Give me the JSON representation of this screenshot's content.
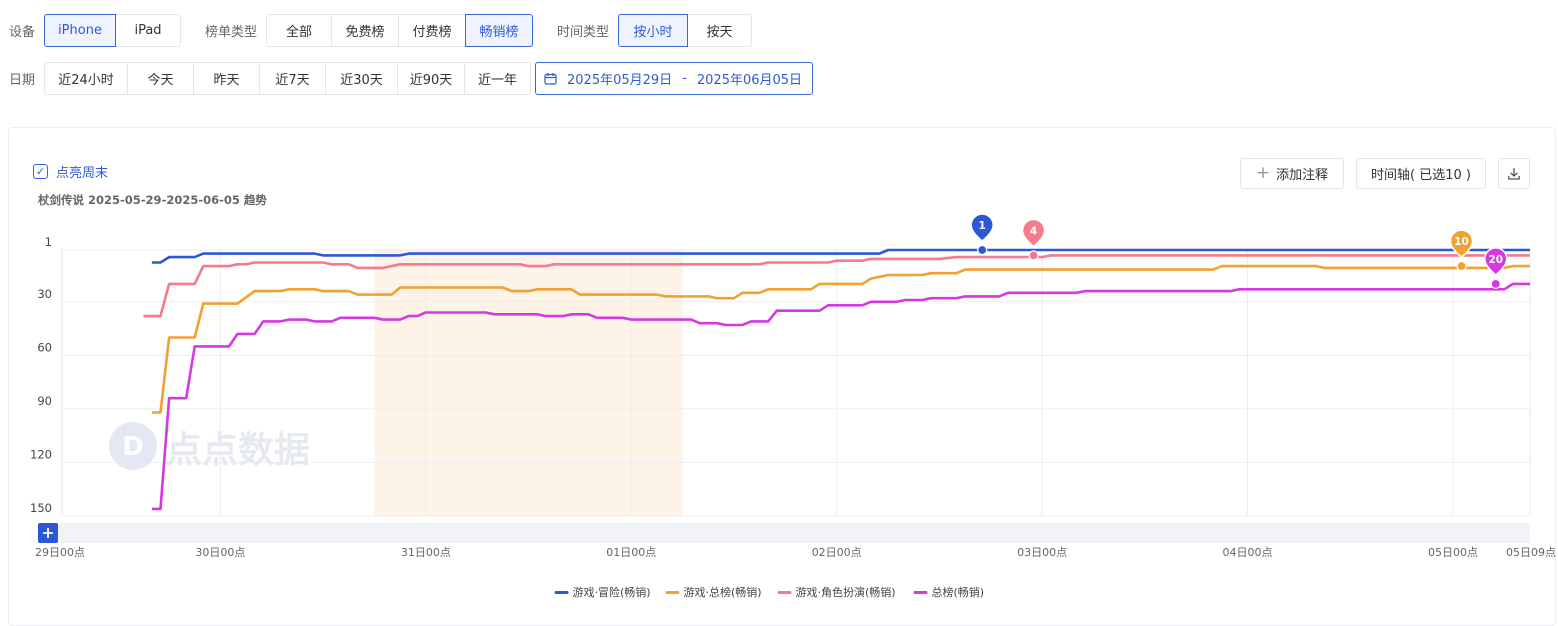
{
  "filters": {
    "device": {
      "label": "设备",
      "options": [
        "iPhone",
        "iPad"
      ],
      "selected": "iPhone"
    },
    "chart_kind": {
      "label": "榜单类型",
      "options": [
        "全部",
        "免费榜",
        "付费榜",
        "畅销榜"
      ],
      "selected": "畅销榜"
    },
    "time_kind": {
      "label": "时间类型",
      "options": [
        "按小时",
        "按天"
      ],
      "selected": "按小时"
    },
    "date": {
      "label": "日期",
      "options": [
        "近24小时",
        "今天",
        "昨天",
        "近7天",
        "近30天",
        "近90天",
        "近一年"
      ],
      "range_start": "2025年05月29日",
      "range_sep": "-",
      "range_end": "2025年06月05日"
    }
  },
  "toolbar": {
    "weekend_label": "点亮周末",
    "weekend_checked": true,
    "add_note_label": "添加注释",
    "timeline_label": "时间轴( 已选10 )",
    "download_icon": "download-icon"
  },
  "watermark": "点点数据",
  "accent_color": "#2f5bd2",
  "chart_data": {
    "type": "line",
    "title": "杖剑传说 2025-05-29-2025-06-05 趋势",
    "y_axis": {
      "inverted": true,
      "range": [
        1,
        150
      ],
      "ticks": [
        1,
        30,
        60,
        90,
        120,
        150
      ]
    },
    "x_axis": {
      "range_hours": [
        0,
        177
      ],
      "ticks": [
        {
          "h": 0,
          "label": "29日00点"
        },
        {
          "h": 24,
          "label": "30日00点"
        },
        {
          "h": 48,
          "label": "31日00点"
        },
        {
          "h": 72,
          "label": "01日00点"
        },
        {
          "h": 96,
          "label": "02日00点"
        },
        {
          "h": 120,
          "label": "03日00点"
        },
        {
          "h": 144,
          "label": "04日00点"
        },
        {
          "h": 168,
          "label": "05日00点"
        },
        {
          "h": 177,
          "label": "05日09点"
        }
      ]
    },
    "highlight_weekend": {
      "from_h": 42,
      "to_h": 78
    },
    "grid": true,
    "legend_position": "bottom",
    "series": [
      {
        "name": "游戏·冒险(畅销)",
        "color": "#2c58d8",
        "points": [
          [
            16,
            8
          ],
          [
            17,
            8
          ],
          [
            18,
            5
          ],
          [
            21,
            5
          ],
          [
            22,
            3
          ],
          [
            35,
            3
          ],
          [
            36,
            4
          ],
          [
            45,
            4
          ],
          [
            46,
            3
          ],
          [
            101,
            3
          ],
          [
            102,
            1
          ],
          [
            177,
            1
          ]
        ],
        "marker": {
          "h": 113,
          "rank": 1
        }
      },
      {
        "name": "游戏·总榜(畅销)",
        "color": "#f0a132",
        "points": [
          [
            16,
            92
          ],
          [
            17,
            92
          ],
          [
            18,
            50
          ],
          [
            21,
            50
          ],
          [
            22,
            31
          ],
          [
            26,
            31
          ],
          [
            28,
            24
          ],
          [
            31,
            24
          ],
          [
            32,
            23
          ],
          [
            35,
            23
          ],
          [
            36,
            24
          ],
          [
            39,
            24
          ],
          [
            40,
            26
          ],
          [
            44,
            26
          ],
          [
            45,
            22
          ],
          [
            57,
            22
          ],
          [
            58,
            24
          ],
          [
            60,
            24
          ],
          [
            61,
            23
          ],
          [
            65,
            23
          ],
          [
            66,
            26
          ],
          [
            75,
            26
          ],
          [
            76,
            27
          ],
          [
            81,
            27
          ],
          [
            82,
            28
          ],
          [
            84,
            28
          ],
          [
            85,
            25
          ],
          [
            87,
            25
          ],
          [
            88,
            23
          ],
          [
            93,
            23
          ],
          [
            94,
            20
          ],
          [
            99,
            20
          ],
          [
            100,
            17
          ],
          [
            102,
            15
          ],
          [
            106,
            15
          ],
          [
            107,
            14
          ],
          [
            110,
            14
          ],
          [
            111,
            12
          ],
          [
            140,
            12
          ],
          [
            141,
            10
          ],
          [
            152,
            10
          ],
          [
            153,
            11
          ],
          [
            174,
            11
          ],
          [
            175,
            10
          ],
          [
            177,
            10
          ]
        ],
        "marker": {
          "h": 169,
          "rank": 10
        }
      },
      {
        "name": "游戏·角色扮演(畅销)",
        "color": "#f47a8c",
        "points": [
          [
            15,
            38
          ],
          [
            17,
            38
          ],
          [
            18,
            20
          ],
          [
            21,
            20
          ],
          [
            22,
            10
          ],
          [
            25,
            10
          ],
          [
            26,
            9
          ],
          [
            27,
            9
          ],
          [
            28,
            8
          ],
          [
            36,
            8
          ],
          [
            37,
            9
          ],
          [
            39,
            9
          ],
          [
            40,
            11
          ],
          [
            43,
            11
          ],
          [
            45,
            9
          ],
          [
            59,
            9
          ],
          [
            60,
            10
          ],
          [
            62,
            10
          ],
          [
            63,
            9
          ],
          [
            87,
            9
          ],
          [
            88,
            8
          ],
          [
            95,
            8
          ],
          [
            96,
            7
          ],
          [
            99,
            7
          ],
          [
            100,
            6
          ],
          [
            108,
            6
          ],
          [
            110,
            5
          ],
          [
            120,
            5
          ],
          [
            121,
            4
          ],
          [
            177,
            4
          ]
        ],
        "marker": {
          "h": 119,
          "rank": 4
        }
      },
      {
        "name": "总榜(畅销)",
        "color": "#d43ae0",
        "points": [
          [
            16,
            146
          ],
          [
            17,
            146
          ],
          [
            18,
            84
          ],
          [
            20,
            84
          ],
          [
            21,
            55
          ],
          [
            25,
            55
          ],
          [
            26,
            48
          ],
          [
            28,
            48
          ],
          [
            29,
            41
          ],
          [
            31,
            41
          ],
          [
            32,
            40
          ],
          [
            34,
            40
          ],
          [
            35,
            41
          ],
          [
            37,
            41
          ],
          [
            38,
            39
          ],
          [
            42,
            39
          ],
          [
            43,
            40
          ],
          [
            45,
            40
          ],
          [
            46,
            38
          ],
          [
            47,
            38
          ],
          [
            48,
            36
          ],
          [
            55,
            36
          ],
          [
            56,
            37
          ],
          [
            61,
            37
          ],
          [
            62,
            38
          ],
          [
            64,
            38
          ],
          [
            65,
            37
          ],
          [
            67,
            37
          ],
          [
            68,
            39
          ],
          [
            71,
            39
          ],
          [
            72,
            40
          ],
          [
            79,
            40
          ],
          [
            80,
            42
          ],
          [
            82,
            42
          ],
          [
            83,
            43
          ],
          [
            85,
            43
          ],
          [
            86,
            41
          ],
          [
            88,
            41
          ],
          [
            89,
            35
          ],
          [
            94,
            35
          ],
          [
            95,
            32
          ],
          [
            99,
            32
          ],
          [
            100,
            30
          ],
          [
            103,
            30
          ],
          [
            104,
            29
          ],
          [
            106,
            29
          ],
          [
            107,
            28
          ],
          [
            110,
            28
          ],
          [
            111,
            27
          ],
          [
            115,
            27
          ],
          [
            116,
            25
          ],
          [
            124,
            25
          ],
          [
            125,
            24
          ],
          [
            142,
            24
          ],
          [
            143,
            23
          ],
          [
            174,
            23
          ],
          [
            175,
            20
          ],
          [
            177,
            20
          ]
        ],
        "marker": {
          "h": 173,
          "rank": 20
        }
      }
    ]
  }
}
